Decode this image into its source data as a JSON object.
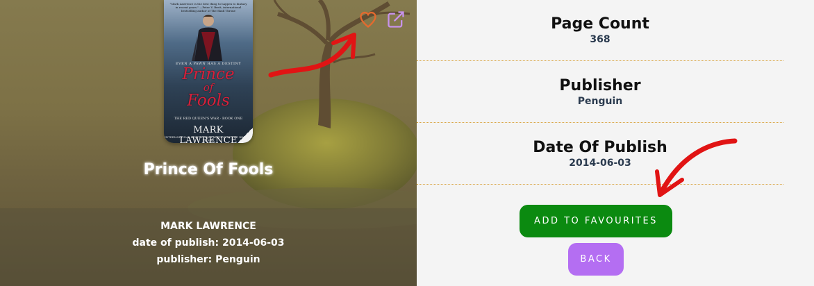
{
  "book": {
    "title": "Prince Of Fools",
    "author": "MARK LAWRENCE",
    "date_of_publish_line": "date of publish: 2014-06-03",
    "publisher_line": "publisher: Penguin"
  },
  "cover": {
    "blurb": "\"Mark Lawrence is the best thing to happen to fantasy in recent years.\" —Peter V. Brett, international bestselling author of The Skull Throne",
    "tagline": "EVEN A PAWN HAS A DESTINY",
    "title_line1": "Prince",
    "title_line2": "of",
    "title_line3": "Fools",
    "series": "THE RED QUEEN'S WAR · BOOK ONE",
    "author": "MARK LAWRENCE",
    "bottom": "INTERNATIONAL BESTSELLING AUTHOR OF THE BROKEN EMPIRE"
  },
  "details": [
    {
      "label": "Page Count",
      "value": "368"
    },
    {
      "label": "Publisher",
      "value": "Penguin"
    },
    {
      "label": "Date Of Publish",
      "value": "2014-06-03"
    }
  ],
  "buttons": {
    "add_to_favourites": "ADD TO FAVOURITES",
    "back": "BACK"
  },
  "icons": {
    "favourite": "heart-outline-icon",
    "open_external": "external-link-icon"
  },
  "colors": {
    "heart": "#e46a2e",
    "external_link": "#c792ea",
    "add_button": "#0b8a10",
    "back_button": "#b46ef2",
    "annotation_arrow": "#e11414"
  }
}
